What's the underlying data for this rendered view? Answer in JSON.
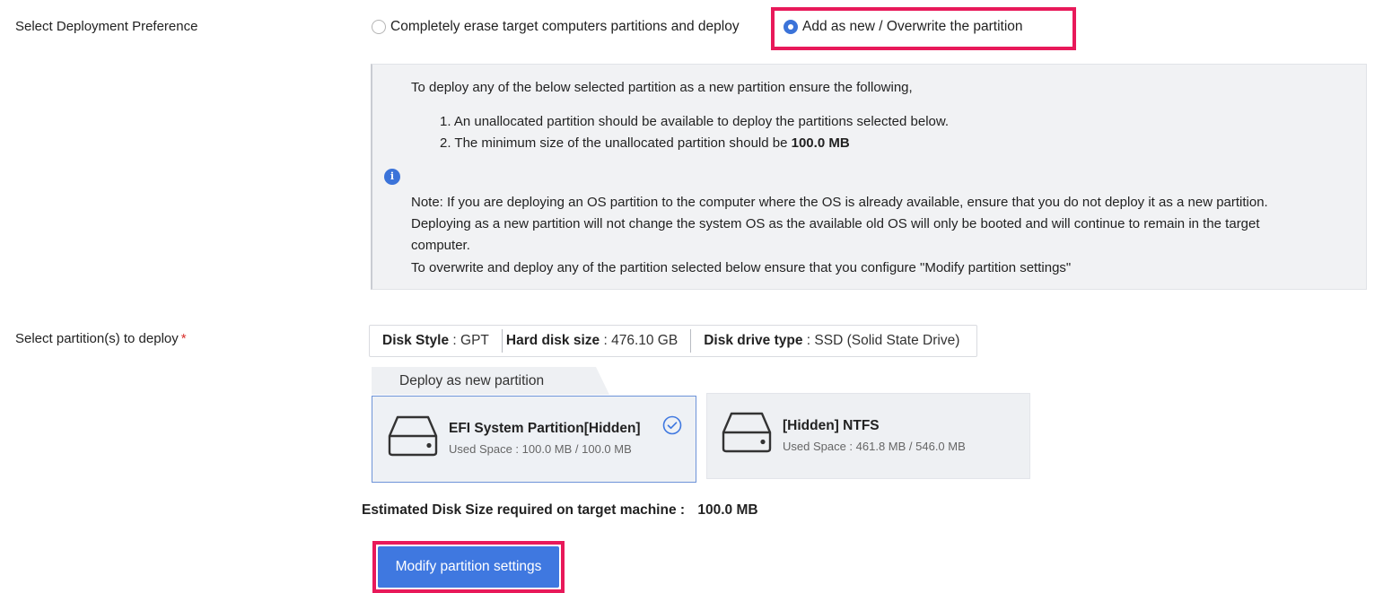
{
  "deployment_preference": {
    "label": "Select Deployment Preference",
    "options": [
      {
        "label": "Completely erase target computers partitions and deploy",
        "selected": false
      },
      {
        "label": "Add as new / Overwrite the partition",
        "selected": true
      }
    ]
  },
  "info": {
    "intro": "To deploy any of the below selected partition as a new partition ensure the following,",
    "item1": "1. An unallocated partition should be available to deploy the partitions selected below.",
    "item2_prefix": "2. The minimum size of the unallocated partition should be ",
    "item2_value": "100.0 MB",
    "icon": "i",
    "note_line1": "Note: If you are deploying an OS partition to the computer where the OS is already available, ensure that you do not deploy it as a new partition.",
    "note_line2": "Deploying as a new partition will not change the system OS as the available old OS will only be booted and will continue to remain in the target",
    "note_line3": "computer.",
    "note_line4": "To overwrite and deploy any of the partition selected below ensure that you configure \"Modify partition settings\""
  },
  "partitions": {
    "label": "Select partition(s) to deploy",
    "required_mark": "*",
    "disk_info": {
      "style_label": "Disk Style",
      "style_value": ": GPT",
      "size_label": "Hard disk size",
      "size_value": ": 476.10 GB",
      "type_label": "Disk drive type",
      "type_value": ": SSD (Solid State Drive)"
    },
    "tab_label": "Deploy as new partition",
    "cards": [
      {
        "title": "EFI System Partition[Hidden]",
        "used": "Used Space : 100.0 MB / 100.0 MB",
        "selected": true,
        "icon": "hard-drive-icon"
      },
      {
        "title": "[Hidden] NTFS",
        "used": "Used Space : 461.8 MB / 546.0 MB",
        "selected": false,
        "icon": "hard-drive-icon"
      }
    ]
  },
  "estimate": {
    "label": "Estimated Disk Size required on target machine :",
    "value": "100.0 MB"
  },
  "modify_button": {
    "label": "Modify partition settings"
  },
  "colors": {
    "accent": "#3f78e0",
    "highlight": "#e8195a",
    "required": "#d9302c"
  }
}
